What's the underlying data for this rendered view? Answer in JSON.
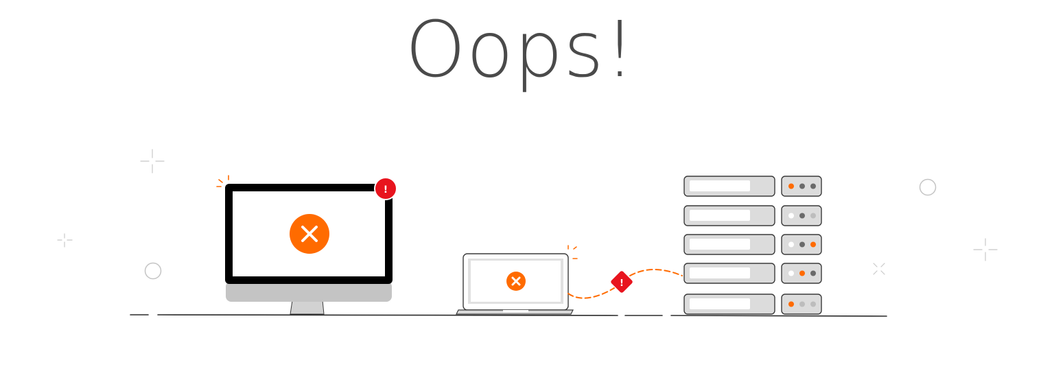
{
  "page": {
    "title": "Oops!"
  },
  "illustration": {
    "alert_glyph": "!",
    "devices": {
      "desktop": {
        "status": "error",
        "icon": "close-icon"
      },
      "laptop": {
        "status": "error",
        "icon": "close-icon"
      },
      "connection": {
        "status": "broken",
        "icon": "warning-diamond-icon"
      },
      "server_rack": {
        "units": 5
      }
    }
  },
  "colors": {
    "accent_orange": "#ff6b00",
    "alert_red": "#e8141e",
    "outline_dark": "#3a3a3a",
    "monitor_bezel": "#000000",
    "panel_gray": "#dcdcdc",
    "stand_gray": "#c4c4c4",
    "title_gray": "#4a4a4a"
  }
}
